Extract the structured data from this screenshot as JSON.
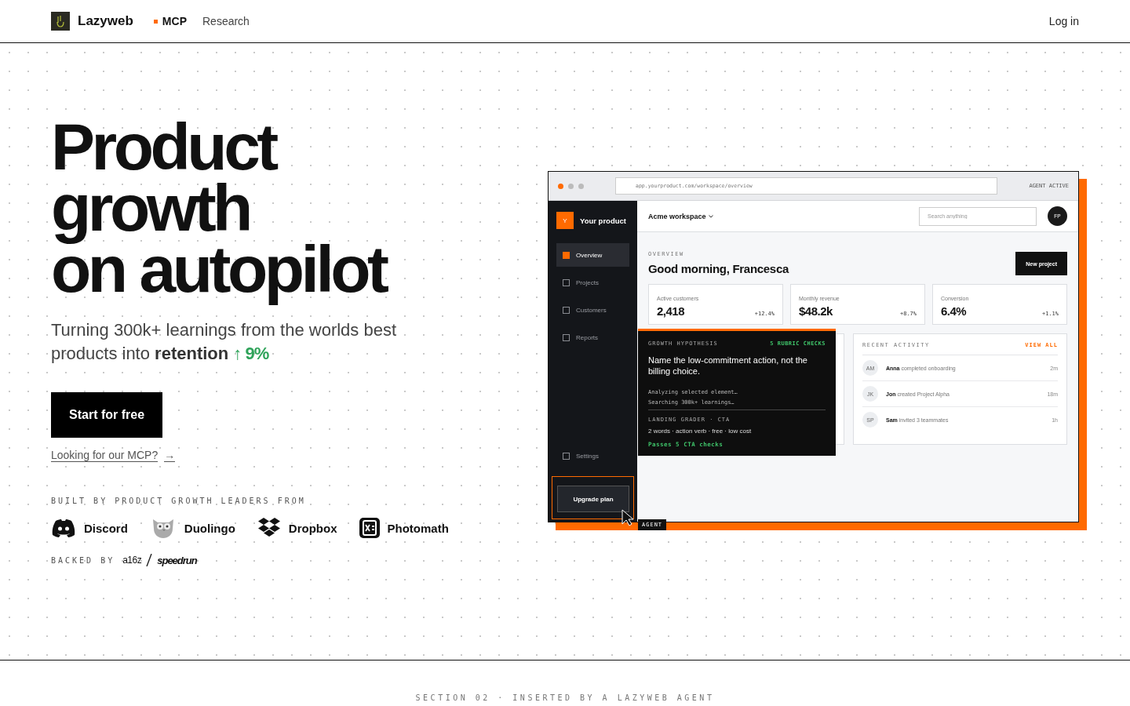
{
  "nav": {
    "brand": "Lazyweb",
    "links": [
      {
        "label": "MCP",
        "selected": true
      },
      {
        "label": "Research",
        "selected": false
      }
    ],
    "login": "Log in"
  },
  "hero": {
    "title_lines": [
      "Product",
      "growth",
      "on autopilot"
    ],
    "subtitle": "Turning 300k+ learnings from the worlds best products into",
    "highlight": "retention",
    "metric_arrow": "↑",
    "metric": "9%",
    "cta": "Start for free",
    "mcp_link": "Looking for our MCP?",
    "mcp_arrow": "→"
  },
  "companies_label": "BUILT BY PRODUCT GROWTH LEADERS FROM",
  "companies": [
    {
      "name": "Discord",
      "kind": "discord"
    },
    {
      "name": "Duolingo",
      "kind": "owl"
    },
    {
      "name": "Dropbox",
      "kind": "dropbox"
    },
    {
      "name": "Photomath",
      "kind": "photomath"
    }
  ],
  "backed": {
    "label": "BACKED BY",
    "first": "a16z",
    "second": "speedrun"
  },
  "mockup": {
    "url": "app.yourproduct.com/workspace/overview",
    "status": "AGENT ACTIVE",
    "product_badge": "Y",
    "product": "Your product",
    "sidebar": [
      {
        "label": "Overview",
        "selected": true
      },
      {
        "label": "Projects",
        "selected": false
      },
      {
        "label": "Customers",
        "selected": false
      },
      {
        "label": "Reports",
        "selected": false
      }
    ],
    "settings": "Settings",
    "upgrade": "Upgrade plan",
    "workspace": "Acme workspace",
    "search": {
      "placeholder": "Search anything"
    },
    "user": "FP",
    "eyebrow": "OVERVIEW",
    "greeting": "Good morning, Francesca",
    "new_project": "New project",
    "stats": [
      {
        "label": "Active customers",
        "value": "2,418",
        "change": "+12.4%"
      },
      {
        "label": "Monthly revenue",
        "value": "$48.2k",
        "change": "+8.7%"
      },
      {
        "label": "Conversion",
        "value": "6.4%",
        "change": "+1.1%"
      }
    ],
    "hypothesis": {
      "eyebrow": "GROWTH HYPOTHESIS",
      "checks": "5 RUBRIC CHECKS",
      "headline": "Name the low-commitment action, not the billing choice.",
      "logs": [
        "Analyzing selected element…",
        "Searching 300k+ learnings…"
      ],
      "grader": "LANDING GRADER · CTA",
      "criteria": "2 words · action verb · free · low cost",
      "result": "Passes 5 CTA checks"
    },
    "activity": {
      "title": "RECENT ACTIVITY",
      "view_all": "VIEW ALL",
      "items": [
        {
          "initials": "AM",
          "name": "Anna",
          "action": "completed onboarding",
          "time": "2m"
        },
        {
          "initials": "JK",
          "name": "Jon",
          "action": "created Project Alpha",
          "time": "18m"
        },
        {
          "initials": "SP",
          "name": "Sam",
          "action": "invited 3 teammates",
          "time": "1h"
        }
      ]
    },
    "cursor_label": "AGENT"
  },
  "footer": "SECTION 02 · INSERTED BY A LAZYWEB AGENT"
}
